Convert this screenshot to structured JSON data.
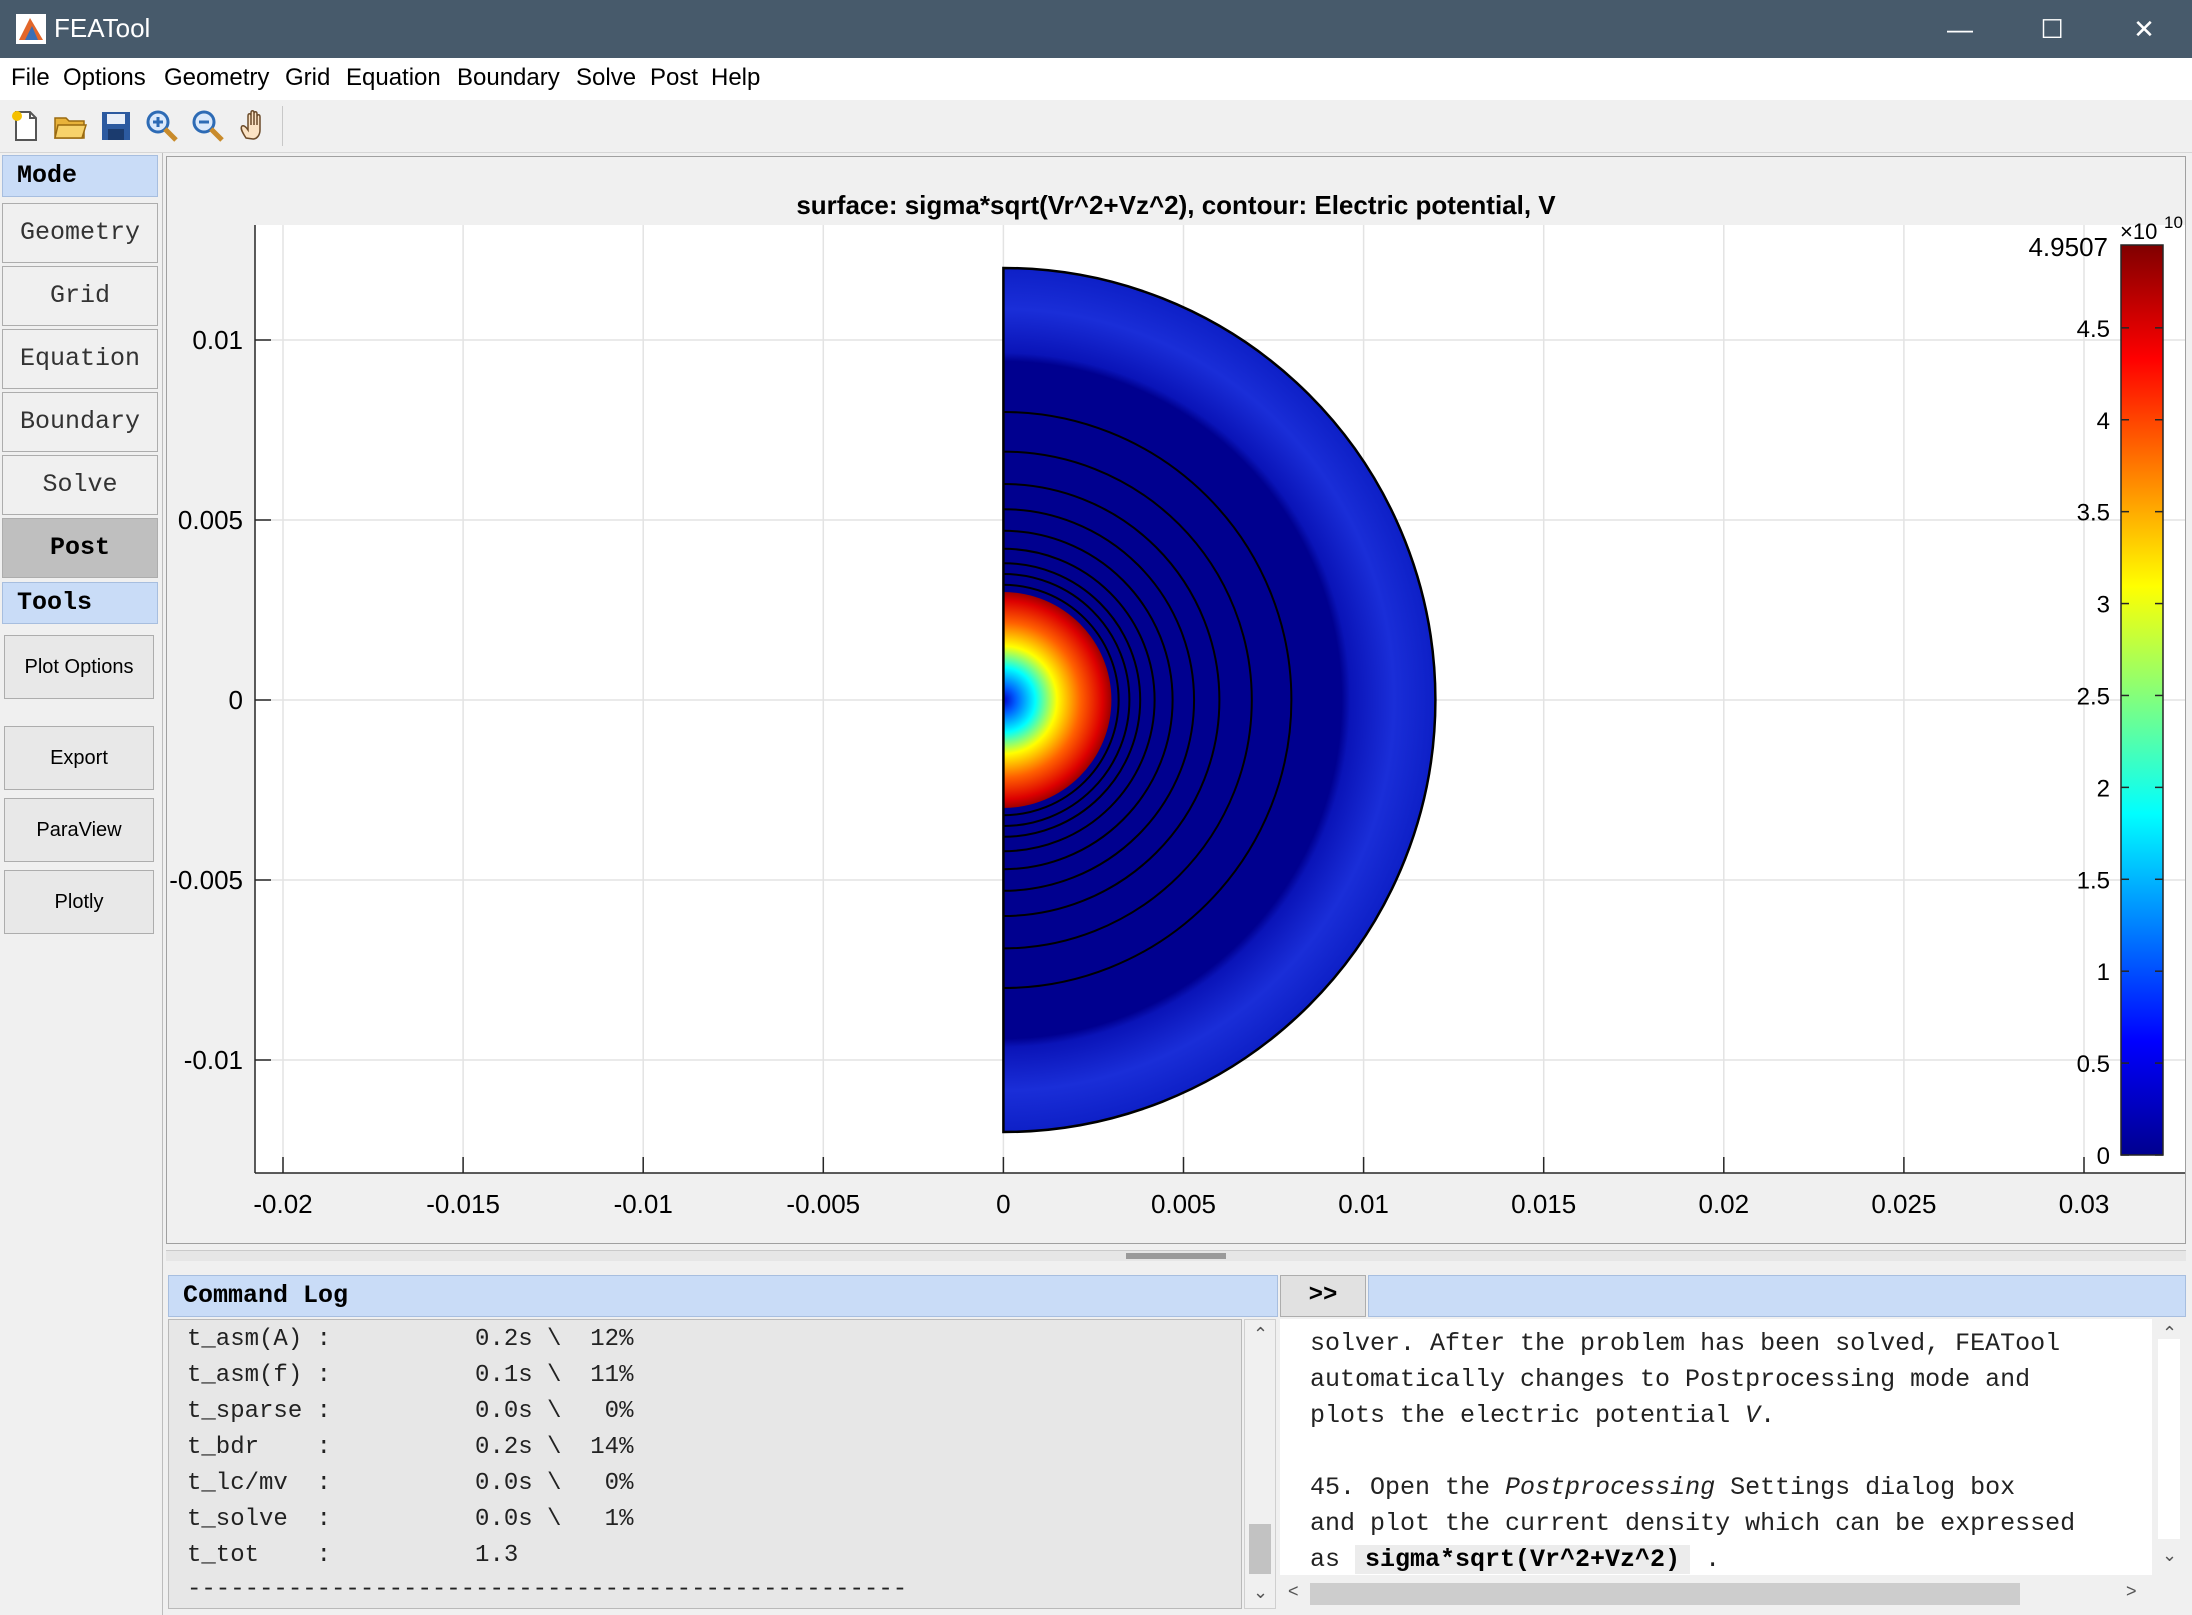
{
  "window": {
    "title": "FEATool",
    "minimize_glyph": "—",
    "maximize_glyph": "☐",
    "close_glyph": "✕"
  },
  "menu": [
    "File",
    "Options",
    "Geometry",
    "Grid",
    "Equation",
    "Boundary",
    "Solve",
    "Post",
    "Help"
  ],
  "toolbar": {
    "icons": [
      "new-file-icon",
      "open-folder-icon",
      "save-icon",
      "zoom-in-icon",
      "zoom-out-icon",
      "pan-hand-icon"
    ]
  },
  "left_panel": {
    "mode_header": "Mode",
    "modes": [
      "Geometry",
      "Grid",
      "Equation",
      "Boundary",
      "Solve",
      "Post"
    ],
    "active_mode": "Post",
    "tools_header": "Tools",
    "tools": [
      "Plot Options",
      "Export",
      "ParaView",
      "Plotly"
    ]
  },
  "plot": {
    "title": "surface: sigma*sqrt(Vr^2+Vz^2), contour: Electric potential, V",
    "x_ticks": [
      "-0.02",
      "-0.015",
      "-0.01",
      "-0.005",
      "0",
      "0.005",
      "0.01",
      "0.015",
      "0.02",
      "0.025",
      "0.03"
    ],
    "y_ticks": [
      "0.01",
      "0.005",
      "0",
      "-0.005",
      "-0.01"
    ],
    "colorbar": {
      "max_label": "4.9507",
      "exponent_base": "×10",
      "exponent": "10",
      "ticks": [
        "4.5",
        "4",
        "3.5",
        "3",
        "2.5",
        "2",
        "1.5",
        "1",
        "0.5",
        "0"
      ],
      "colormap": "jet"
    }
  },
  "chart_data": {
    "type": "heatmap",
    "title": "surface: sigma*sqrt(Vr^2+Vz^2), contour: Electric potential, V",
    "xlabel": "",
    "ylabel": "",
    "xlim": [
      -0.02,
      0.03
    ],
    "ylim": [
      -0.013,
      0.013
    ],
    "x_ticks": [
      -0.02,
      -0.015,
      -0.01,
      -0.005,
      0,
      0.005,
      0.01,
      0.015,
      0.02,
      0.025,
      0.03
    ],
    "y_ticks": [
      -0.01,
      -0.005,
      0,
      0.005,
      0.01
    ],
    "color_range": [
      0,
      49507000000.0
    ],
    "colorbar_ticks": [
      0,
      0.5,
      1,
      1.5,
      2,
      2.5,
      3,
      3.5,
      4,
      4.5
    ],
    "grid": true,
    "domain": {
      "outer_radius": 0.012,
      "inner_sphere_radius": 0.003,
      "shell_inner_radius": 0.0095
    },
    "contour_radii": [
      0.0032,
      0.0035,
      0.0038,
      0.0042,
      0.0047,
      0.0053,
      0.006,
      0.0069,
      0.008
    ],
    "colormap": "jet"
  },
  "command_log": {
    "header": "Command Log",
    "toggle": ">>",
    "lines": [
      "t_asm(A) :          0.2s \\  12%",
      "t_asm(f) :          0.1s \\  11%",
      "t_sparse :          0.0s \\   0%",
      "t_bdr    :          0.2s \\  14%",
      "t_lc/mv  :          0.0s \\   0%",
      "t_solve  :          0.0s \\   1%",
      "t_tot    :          1.3",
      "--------------------------------------------------"
    ]
  },
  "help": {
    "line1": "solver. After the problem has been solved, FEATool",
    "line2": "automatically changes to Postprocessing mode and",
    "line3a": "plots the electric potential ",
    "line3b": "V",
    "line3c": ".",
    "line5a": "45. Open the ",
    "line5b": "Postprocessing",
    "line5c": " Settings dialog box",
    "line6": "and plot the current density which can be expressed",
    "line7a": "as ",
    "line7code": "sigma*sqrt(Vr^2+Vz^2)",
    "line7c": " ."
  }
}
